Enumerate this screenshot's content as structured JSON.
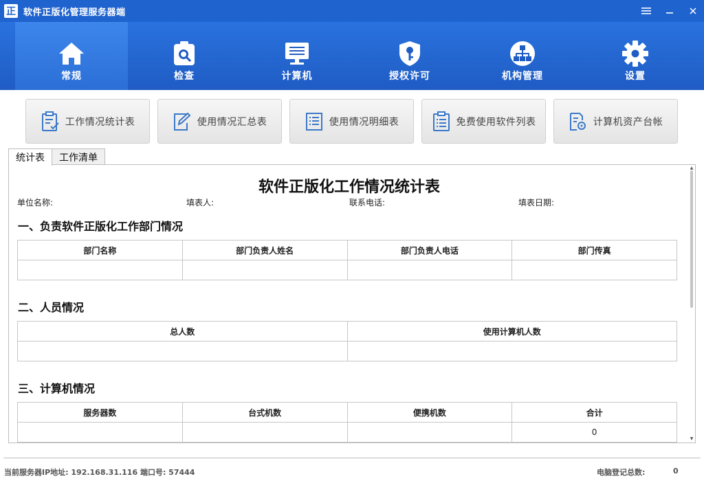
{
  "window": {
    "logo_text": "正",
    "title": "软件正版化管理服务器端"
  },
  "nav": {
    "items": [
      {
        "label": "常规",
        "icon": "home-icon"
      },
      {
        "label": "检查",
        "icon": "search-check-icon"
      },
      {
        "label": "计算机",
        "icon": "computer-icon"
      },
      {
        "label": "授权许可",
        "icon": "license-shield-icon"
      },
      {
        "label": "机构管理",
        "icon": "org-chart-icon"
      },
      {
        "label": "设置",
        "icon": "gear-icon"
      }
    ],
    "active_index": 0
  },
  "subbar": {
    "items": [
      {
        "label": "工作情况统计表",
        "icon": "clipboard-check-icon"
      },
      {
        "label": "使用情况汇总表",
        "icon": "edit-icon"
      },
      {
        "label": "使用情况明细表",
        "icon": "list-icon"
      },
      {
        "label": "免费使用软件列表",
        "icon": "clipboard-list-icon"
      },
      {
        "label": "计算机资产台帐",
        "icon": "document-gear-icon"
      }
    ]
  },
  "tabs": [
    {
      "label": "统计表",
      "active": true
    },
    {
      "label": "工作清单",
      "active": false
    }
  ],
  "report": {
    "title": "软件正版化工作情况统计表",
    "meta": {
      "unit_name": "单位名称:",
      "filler": "填表人:",
      "phone": "联系电话:",
      "date": "填表日期:"
    },
    "section1": {
      "title": "一、负责软件正版化工作部门情况",
      "headers": [
        "部门名称",
        "部门负责人姓名",
        "部门负责人电话",
        "部门传真"
      ],
      "row": [
        "",
        "",
        "",
        ""
      ]
    },
    "section2": {
      "title": "二、人员情况",
      "headers": [
        "总人数",
        "使用计算机人数"
      ],
      "row": [
        "",
        ""
      ]
    },
    "section3": {
      "title": "三、计算机情况",
      "headers": [
        "服务器数",
        "台式机数",
        "便携机数",
        "合计"
      ],
      "row": [
        "",
        "",
        "",
        "0"
      ]
    }
  },
  "status": {
    "server": "当前服务器IP地址: 192.168.31.116  端口号: 57444",
    "registered_label": "电脑登记总数:",
    "registered_count": "0"
  },
  "colors": {
    "titlebar": "#1f63cf",
    "nav": "#2a72de",
    "nav_active": "#3d86ec",
    "icon_blue": "#3a78c9"
  }
}
